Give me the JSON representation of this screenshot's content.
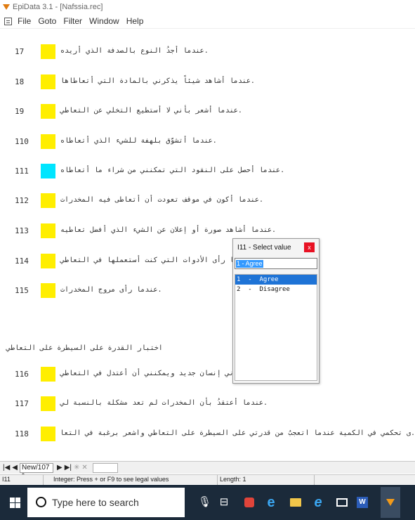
{
  "window": {
    "title": "EpiData 3.1 - [Nafssia.rec]"
  },
  "menu": {
    "items": [
      "File",
      "Goto",
      "Filter",
      "Window",
      "Help"
    ]
  },
  "colors": {
    "field_yellow": "#ffee00",
    "field_active": "#00e5ff",
    "selection_blue": "#1e73d6",
    "close_red": "#e81123",
    "taskbar_bg": "#1b2a3a"
  },
  "questions": [
    {
      "num": "17",
      "text": ".عندما أجدُ النوع بالصدفة الذي أريده",
      "state": "filled"
    },
    {
      "num": "18",
      "text": ".عندما أشاهد شيئاً يذكرني بالمادة التي أتعاطاها",
      "state": "filled"
    },
    {
      "num": "19",
      "text": ".عندما أشعر بأني لا أستطيع التخلي عن التعاطي",
      "state": "filled"
    },
    {
      "num": "110",
      "text": ".عندما أتشوّق بلهفة للشيء الذي أتعاطاه",
      "state": "filled"
    },
    {
      "num": "111",
      "text": ".عندما أحصل على النقود التي تمكنني من شراء ما أتعاطاه",
      "state": "active"
    },
    {
      "num": "112",
      "text": ".عندما أكون في موقف تعودت أن أتعاطى فيه المخدرات",
      "state": "filled"
    },
    {
      "num": "113",
      "text": ".عندما أشاهد صورة أو إعلان عن الشيء الذي أفضل تعاطيه",
      "state": "filled"
    },
    {
      "num": "114",
      "text": ".عندما رأى الأدوات التي كنت أستعملها في التعاطي",
      "state": "filled"
    },
    {
      "num": "115",
      "text": ".عندما رأى مروج المخدرات",
      "state": "filled"
    },
    {
      "num": "116",
      "text": ".عندما أقتنع نفسي بأني إنسان جديد ويمكنني أن أعتدل في التعاطي",
      "state": "filled"
    },
    {
      "num": "117",
      "text": ".عندما أعتقدُ بأن المخدرات لم تعد مشكلة بالنسبة لي",
      "state": "filled"
    },
    {
      "num": "118",
      "text": ".ى تحكمي في الكمية عندما أتعجبُ من قدرتي على السيطرة على التعاطي وأشعر برغبة في التعاطي لاختبار مد",
      "state": "filled"
    }
  ],
  "section_heading": "اختبار القدرة على السيطرة على التعاطي",
  "popup": {
    "title": "I11 - Select value",
    "close": "x",
    "input_value": "1 - Agree",
    "options": [
      "1  -  Agree",
      "2  -  Disagree"
    ],
    "selected_index": 0
  },
  "navbar": {
    "first": "|◀",
    "prev": "◀",
    "record": "New/107 *",
    "next": "▶",
    "last": "▶|",
    "new": "✳",
    "delete": "✕"
  },
  "status": {
    "field": "I11",
    "hint": "Integer:  Press + or F9 to see legal values",
    "length": "Length: 1"
  },
  "taskbar": {
    "search_placeholder": "Type here to search",
    "word_label": "W"
  }
}
